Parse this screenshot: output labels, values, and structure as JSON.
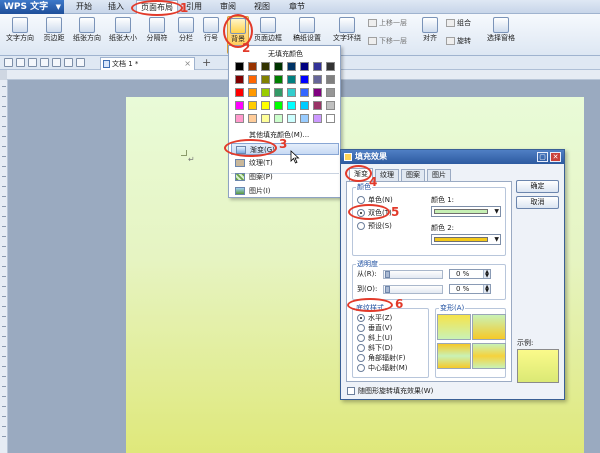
{
  "app": {
    "logo_label": "WPS 文字"
  },
  "menu": [
    "开始",
    "插入",
    "页面布局",
    "引用",
    "审阅",
    "视图",
    "章节"
  ],
  "ribbon": {
    "text_direction": "文字方向",
    "margins": "页边距",
    "orientation": "纸张方向",
    "paper_size": "纸张大小",
    "columns": "分隔符",
    "breaks": "分栏",
    "line_numbers": "行号",
    "background": "背景",
    "page_border": "页面边框",
    "manuscript": "稿纸设置",
    "text_wrap": "文字环绕",
    "bring_forward": "上移一层",
    "send_backward": "下移一层",
    "align": "对齐",
    "group": "组合",
    "rotate": "旋转",
    "selection_pane": "选择窗格"
  },
  "document_tab": {
    "title": "文档 1 *",
    "close": "×",
    "add": "+"
  },
  "background_menu": {
    "no_fill": "无填充颜色",
    "more_colors": "其他填充颜色(M)...",
    "items": [
      "渐变(G)",
      "纹理(T)",
      "图案(P)",
      "图片(I)"
    ],
    "swatch_colors": [
      [
        "#000000",
        "#993300",
        "#333300",
        "#003300",
        "#003366",
        "#000080",
        "#333399",
        "#333333"
      ],
      [
        "#800000",
        "#ff6600",
        "#808000",
        "#008000",
        "#008080",
        "#0000ff",
        "#666699",
        "#808080"
      ],
      [
        "#ff0000",
        "#ff9900",
        "#99cc00",
        "#339966",
        "#33cccc",
        "#3366ff",
        "#800080",
        "#969696"
      ],
      [
        "#ff00ff",
        "#ffcc00",
        "#ffff00",
        "#00ff00",
        "#00ffff",
        "#00ccff",
        "#993366",
        "#c0c0c0"
      ],
      [
        "#ff99cc",
        "#ffcc99",
        "#ffff99",
        "#ccffcc",
        "#ccffff",
        "#99ccff",
        "#cc99ff",
        "#ffffff"
      ]
    ]
  },
  "dialog": {
    "title": "填充效果",
    "tabs": [
      "渐变",
      "纹理",
      "图案",
      "图片"
    ],
    "ok": "确定",
    "cancel": "取消",
    "colors_group": "颜色",
    "radio_single": "单色(N)",
    "radio_two": "双色(T)",
    "radio_preset": "预设(S)",
    "color1_label": "颜色 1:",
    "color2_label": "颜色 2:",
    "color1_value": "#c6f0b4",
    "color2_value": "#f3c81a",
    "transparency_group": "透明度",
    "from_label": "从(R):",
    "to_label": "到(O):",
    "from_value": "0 %",
    "to_value": "0 %",
    "shading_group": "底纹样式",
    "shading_styles": [
      "水平(Z)",
      "垂直(V)",
      "斜上(U)",
      "斜下(D)",
      "角部辐射(F)",
      "中心辐射(M)"
    ],
    "variants_label": "变形(A)",
    "sample_label": "示例:",
    "rotate_checkbox": "随图形旋转填充效果(W)"
  },
  "annotations": [
    "1",
    "2",
    "3",
    "4",
    "5",
    "6"
  ]
}
